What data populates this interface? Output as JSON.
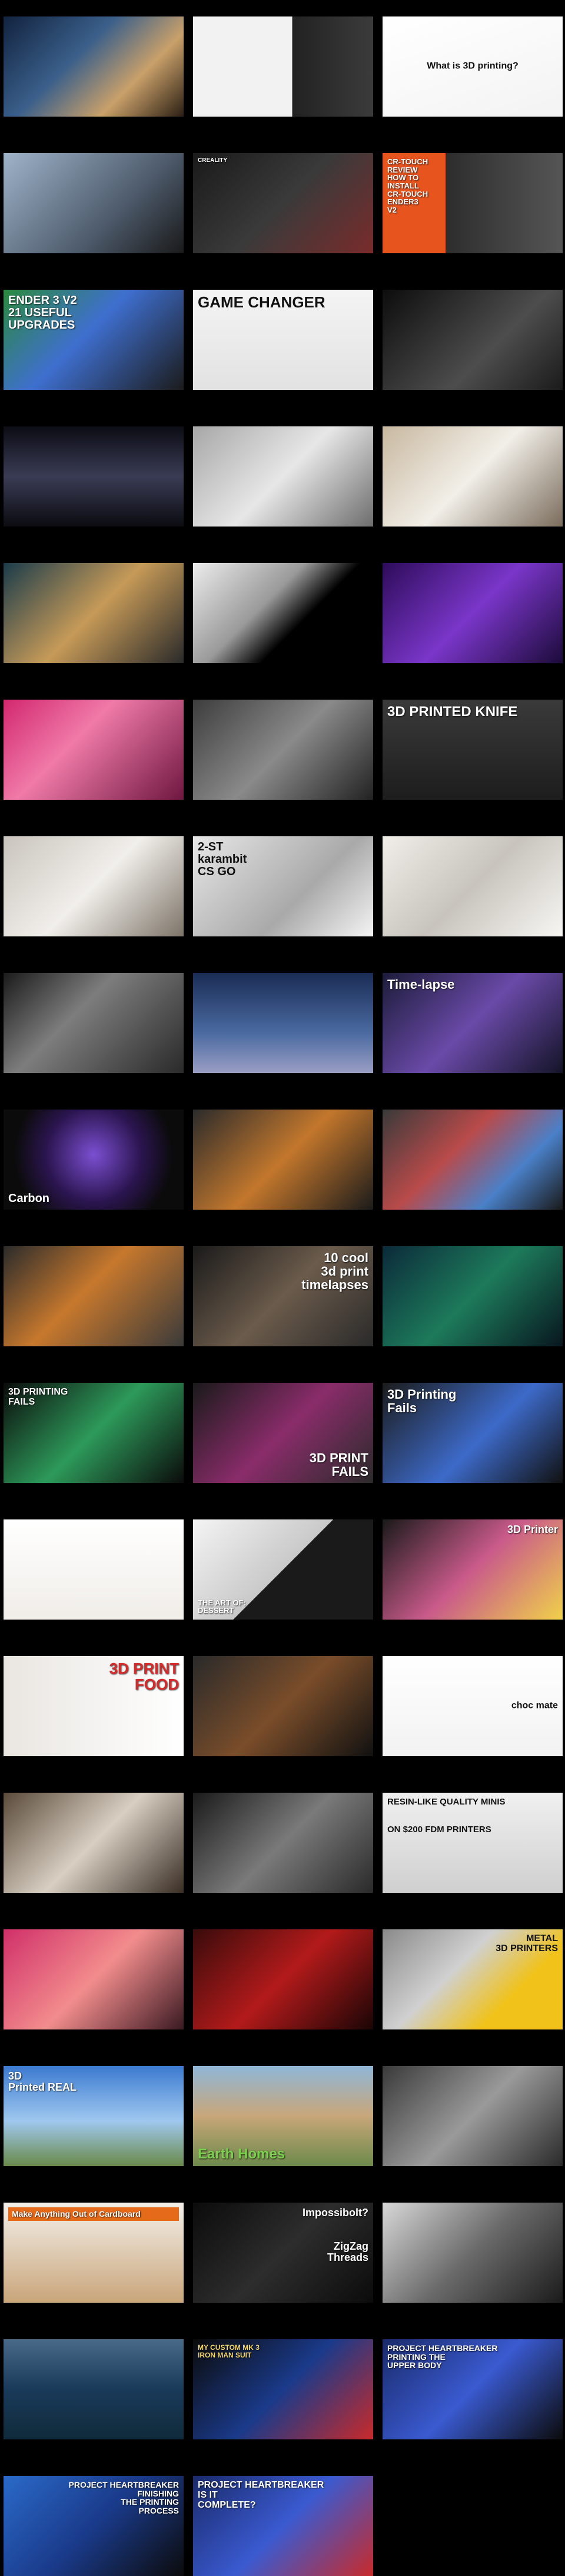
{
  "page": {
    "background": "#000000"
  },
  "tiles": [
    {
      "name": "tile-printer-cube-lab",
      "bg": "linear-gradient(135deg,#12233f,#3a5f8a 40%,#c9a06a 70%,#2b1f14)",
      "caption": "",
      "label_bg": ""
    },
    {
      "name": "tile-z-axis-diagram",
      "bg": "linear-gradient(90deg,#f2f2f2 0%,#f2f2f2 55%,#222 55%,#3b3b3b)",
      "caption": "",
      "label_bg": ""
    },
    {
      "name": "tile-what-is-3d-printing",
      "bg": "linear-gradient(160deg,#ffffff,#f3f3f3)",
      "caption": "What is 3D printing?",
      "caption_style": "dark center",
      "caption_size": 16,
      "label_bg": ""
    },
    {
      "name": "tile-black-printer",
      "bg": "linear-gradient(135deg,#9fb3c9,#4f5d6e 60%,#1a1a1a)",
      "caption": "",
      "label_bg": ""
    },
    {
      "name": "tile-creality-printer",
      "bg": "linear-gradient(135deg,#1a1a1a,#3a3a3a 50%,#7a2b2b)",
      "caption": "CREALITY",
      "caption_style": "top",
      "caption_size": 10,
      "label_bg": ""
    },
    {
      "name": "tile-cr-touch-review",
      "bg": "linear-gradient(90deg,#e8541e 0%,#e8541e 35%,#2d2d2d 35%,#555)",
      "caption": "CR-TOUCH\nREVIEW\nHOW TO\nINSTALL\nCR-TOUCH\nENDER3\nV2",
      "caption_style": "top",
      "caption_size": 13,
      "label_bg": ""
    },
    {
      "name": "tile-21-useful-upgrades",
      "bg": "linear-gradient(135deg,#2b8a3e,#3f6fcf 45%,#1b1b1b)",
      "caption": "ENDER 3 V2\n21 USEFUL\nUPGRADES",
      "caption_style": "top",
      "caption_size": 20,
      "label_bg": ""
    },
    {
      "name": "tile-game-changer",
      "bg": "linear-gradient(180deg,#f4f4f4,#e2e2e2)",
      "caption": "GAME CHANGER",
      "caption_style": "dark top",
      "caption_size": 26,
      "label_bg": ""
    },
    {
      "name": "tile-robot-arm-printer",
      "bg": "linear-gradient(135deg,#0d0d0d,#4d4d4d 60%,#1b1b1b)",
      "caption": "",
      "label_bg": ""
    },
    {
      "name": "tile-fashion-dress-silver",
      "bg": "linear-gradient(180deg,#0c0c14,#3a3c55 50%,#0b0b10)",
      "caption": "",
      "label_bg": ""
    },
    {
      "name": "tile-fashion-model-white",
      "bg": "linear-gradient(135deg,#a7a7a7,#e7e7e7 50%,#6d6d6d)",
      "caption": "",
      "label_bg": ""
    },
    {
      "name": "tile-designer-sketch",
      "bg": "linear-gradient(135deg,#c8b8a0,#f2efe8 50%,#7a6c5c)",
      "caption": "",
      "label_bg": ""
    },
    {
      "name": "tile-headwrap-portrait",
      "bg": "linear-gradient(135deg,#1b3b4a,#c69a58 50%,#2a2a2a)",
      "caption": "",
      "label_bg": ""
    },
    {
      "name": "tile-dim-studio",
      "bg": "linear-gradient(135deg,#ececec,#9a9a9a 40%,#000 60%)",
      "caption": "",
      "label_bg": ""
    },
    {
      "name": "tile-ted-talk-purple",
      "bg": "linear-gradient(135deg,#2d0c5a,#7a36c9 50%,#1c0b3a)",
      "caption": "",
      "label_bg": ""
    },
    {
      "name": "tile-pink-lattice",
      "bg": "linear-gradient(135deg,#d2286f,#f07aa8 40%,#6e1740)",
      "caption": "",
      "label_bg": ""
    },
    {
      "name": "tile-grey-interview",
      "bg": "linear-gradient(135deg,#3d3d3d,#8a8a8a 50%,#222)",
      "caption": "",
      "label_bg": ""
    },
    {
      "name": "tile-3d-printed-knife",
      "bg": "linear-gradient(180deg,#3a3a3a,#1d1d1d)",
      "caption": "3D PRINTED KNIFE",
      "caption_style": "top",
      "caption_size": 24,
      "label_bg": ""
    },
    {
      "name": "tile-butterfly-knife",
      "bg": "linear-gradient(135deg,#c9c4bd,#f1efeb 50%,#7d7468)",
      "caption": "",
      "label_bg": ""
    },
    {
      "name": "tile-karambit-csgo",
      "bg": "linear-gradient(135deg,#e7e7e7,#a9a9a9 60%,#f4f4f4)",
      "caption": "2-ST\nkarambit\nCS GO",
      "caption_style": "dark top",
      "caption_size": 20,
      "label_bg": ""
    },
    {
      "name": "tile-kunai-knife",
      "bg": "linear-gradient(135deg,#f0eee9,#c8c4bd 50%,#f7f6f3)",
      "caption": "",
      "label_bg": ""
    },
    {
      "name": "tile-cardboard-knife",
      "bg": "linear-gradient(135deg,#1b1b1b,#7d7d7d 40%,#2a2a2a)",
      "caption": "",
      "label_bg": ""
    },
    {
      "name": "tile-eiffel-print",
      "bg": "linear-gradient(180deg,#1a2c55,#4a6aa0 60%,#9a9ec4)",
      "caption": "",
      "label_bg": ""
    },
    {
      "name": "tile-time-lapse-statue",
      "bg": "linear-gradient(135deg,#1c1c3a,#6a4aa8 50%,#141428)",
      "caption": "Time-lapse",
      "caption_style": "top",
      "caption_size": 22,
      "label_bg": ""
    },
    {
      "name": "tile-carbon-resin",
      "bg": "radial-gradient(circle at 50% 45%,#7b4fd1,#2b1550 45%,#0b0b0b 75%)",
      "caption": "Carbon",
      "caption_style": "bottom",
      "caption_size": 20,
      "label_bg": ""
    },
    {
      "name": "tile-groot-print",
      "bg": "linear-gradient(135deg,#2b2b2b,#c3772c 50%,#1b1b1b)",
      "caption": "",
      "label_bg": ""
    },
    {
      "name": "tile-skeleton-print",
      "bg": "linear-gradient(135deg,#3a3a3a,#b94a4a 40%,#4a80c8 70%,#1a1a1a)",
      "caption": "",
      "label_bg": ""
    },
    {
      "name": "tile-mouse-figure",
      "bg": "linear-gradient(135deg,#2b2b2b,#c7782d 45%,#3a3a3a)",
      "caption": "",
      "label_bg": ""
    },
    {
      "name": "tile-10-cool-timelapses",
      "bg": "linear-gradient(135deg,#1a1a1a,#6b5b4b 50%,#2a2a2a)",
      "caption": "10 cool\n3d print\ntimelapses",
      "caption_style": "right top",
      "caption_size": 22,
      "label_bg": ""
    },
    {
      "name": "tile-hulk-print",
      "bg": "linear-gradient(135deg,#0b2a3a,#1d7a5a 50%,#08161f)",
      "caption": "",
      "label_bg": ""
    },
    {
      "name": "tile-3d-printing-fails-green",
      "bg": "linear-gradient(135deg,#0b0b0b,#2d9a5a 50%,#0b0b0b)",
      "caption": "3D PRINTING\nFAILS",
      "caption_style": "top",
      "caption_size": 16,
      "label_bg": ""
    },
    {
      "name": "tile-3d-print-fails-pink",
      "bg": "linear-gradient(135deg,#1a1a1a,#8a2c6a 50%,#2a2a2a)",
      "caption": "3D PRINT\nFAILS",
      "caption_style": "right bottom",
      "caption_size": 22,
      "label_bg": ""
    },
    {
      "name": "tile-3d-printing-fails-blue",
      "bg": "linear-gradient(135deg,#1b1b1b,#3d6ac9 55%,#111)",
      "caption": "3D Printing\nFails",
      "caption_style": "top",
      "caption_size": 22,
      "label_bg": ""
    },
    {
      "name": "tile-chocolate-balls",
      "bg": "linear-gradient(180deg,#ffffff,#f0ede8)",
      "caption": "",
      "label_bg": ""
    },
    {
      "name": "tile-art-of-dessert",
      "bg": "linear-gradient(135deg,#f4f4f4,#c9c9c9 50%,#1a1a1a 50%)",
      "caption": "THE ART OF:\nDESSERT",
      "caption_style": "bottom",
      "caption_size": 13,
      "label_bg": ""
    },
    {
      "name": "tile-3d-printer-candy",
      "bg": "linear-gradient(135deg,#1a1a1a,#c95a8a 50%,#f0d24a)",
      "caption": "3D Printer",
      "caption_style": "right top",
      "caption_size": 18,
      "label_bg": ""
    },
    {
      "name": "tile-3d-print-food",
      "bg": "linear-gradient(90deg,#e9e6e1,#ffffff)",
      "caption": "3D PRINT\nFOOD",
      "caption_style": "right top",
      "caption_size": 26,
      "caption_color": "#d62b2b",
      "label_bg": ""
    },
    {
      "name": "tile-food-printer",
      "bg": "linear-gradient(135deg,#2a2a2a,#7a4d2a 50%,#111)",
      "caption": "",
      "label_bg": ""
    },
    {
      "name": "tile-choc-mate",
      "bg": "linear-gradient(180deg,#ffffff,#f2f2f2)",
      "caption": "choc mate",
      "caption_style": "dark right center",
      "caption_size": 16,
      "label_bg": ""
    },
    {
      "name": "tile-spiral-print",
      "bg": "linear-gradient(135deg,#5a4a3a,#d8cfc2 50%,#3a2e24)",
      "caption": "",
      "label_bg": ""
    },
    {
      "name": "tile-miniatures",
      "bg": "linear-gradient(135deg,#1a1a1a,#7a7a7a 50%,#2a2a2a)",
      "caption": "",
      "label_bg": ""
    },
    {
      "name": "tile-resin-like-minis",
      "bg": "linear-gradient(180deg,#f0f0f0,#cfcfcf)",
      "caption": "RESIN-LIKE QUALITY MINIS\n\n\nON $200 FDM PRINTERS",
      "caption_style": "dark top",
      "caption_size": 15,
      "label_bg": ""
    },
    {
      "name": "tile-portrait-bust",
      "bg": "linear-gradient(135deg,#d0306a,#f28c8c 50%,#3a1a22)",
      "caption": "",
      "label_bg": ""
    },
    {
      "name": "tile-red-stage-talk",
      "bg": "linear-gradient(135deg,#3a0b0b,#b31a1a 50%,#1a0505)",
      "caption": "",
      "label_bg": ""
    },
    {
      "name": "tile-metal-3d-printers",
      "bg": "linear-gradient(135deg,#8a8a8a,#d0d0d0 40%,#f0c21a 70%)",
      "caption": "METAL\n3D PRINTERS",
      "caption_style": "dark right top",
      "caption_size": 16,
      "label_bg": ""
    },
    {
      "name": "tile-3d-printed-real",
      "bg": "linear-gradient(180deg,#3c7ad0,#9fc8ef 55%,#6a8a4a)",
      "caption": "3D\nPrinted     REAL",
      "caption_style": "top",
      "caption_size": 18,
      "label_bg": ""
    },
    {
      "name": "tile-earth-homes",
      "bg": "linear-gradient(180deg,#8fb7d8,#c8a67a 50%,#6d8a4a)",
      "caption": "Earth Homes",
      "caption_style": "bottom",
      "caption_size": 24,
      "caption_color": "#7bd14f",
      "label_bg": ""
    },
    {
      "name": "tile-concrete-printing",
      "bg": "linear-gradient(135deg,#3a3a3a,#9a9a9a 50%,#2a2a2a)",
      "caption": "",
      "label_bg": ""
    },
    {
      "name": "tile-cardboard-anything",
      "bg": "linear-gradient(180deg,#f3f0ea,#c9a57a)",
      "caption": "Make Anything Out of Cardboard",
      "caption_style": "top",
      "caption_size": 14,
      "caption_bg": "#e56a1a",
      "label_bg": ""
    },
    {
      "name": "tile-impossibolt",
      "bg": "linear-gradient(135deg,#0b0b0b,#2d2d2d 50%,#0b0b0b)",
      "caption": "Impossibolt?\n\n\nZigZag\nThreads",
      "caption_style": "right top",
      "caption_size": 18,
      "label_bg": ""
    },
    {
      "name": "tile-top-gear-car",
      "bg": "linear-gradient(135deg,#d8d8d8,#6a6a6a 50%,#1b1b1b)",
      "caption": "",
      "label_bg": ""
    },
    {
      "name": "tile-printed-boat",
      "bg": "linear-gradient(180deg,#4a6a8a,#1a3a5a 50%,#0f2a3a)",
      "caption": "",
      "label_bg": ""
    },
    {
      "name": "tile-iron-man-suit",
      "bg": "linear-gradient(135deg,#0b0b0b,#1a3a8a 50%,#c92a2a)",
      "caption": "MY CUSTOM MK 3\nIRON MAN SUIT",
      "caption_style": "top",
      "caption_size": 12,
      "caption_color": "#f5d86a",
      "label_bg": ""
    },
    {
      "name": "tile-printing-upper-body",
      "bg": "linear-gradient(135deg,#1a2a6a,#3a5ad0 50%,#0b0b0b)",
      "caption": "PROJECT HEARTBREAKER\nPRINTING THE\nUPPER BODY",
      "caption_style": "top",
      "caption_size": 14,
      "label_bg": ""
    },
    {
      "name": "tile-finishing-printing-process",
      "bg": "linear-gradient(135deg,#2a6ac9,#1a3a8a 50%,#0b0b0b)",
      "caption": "PROJECT HEARTBREAKER\nFINISHING\nTHE PRINTING\nPROCESS",
      "caption_style": "right top",
      "caption_size": 14,
      "label_bg": ""
    },
    {
      "name": "tile-is-it-complete",
      "bg": "linear-gradient(135deg,#1a2a6a,#3a5ad0 50%,#c92a2a)",
      "caption": "PROJECT HEARTBREAKER\nIS IT\nCOMPLETE?",
      "caption_style": "top",
      "caption_size": 16,
      "label_bg": ""
    }
  ]
}
